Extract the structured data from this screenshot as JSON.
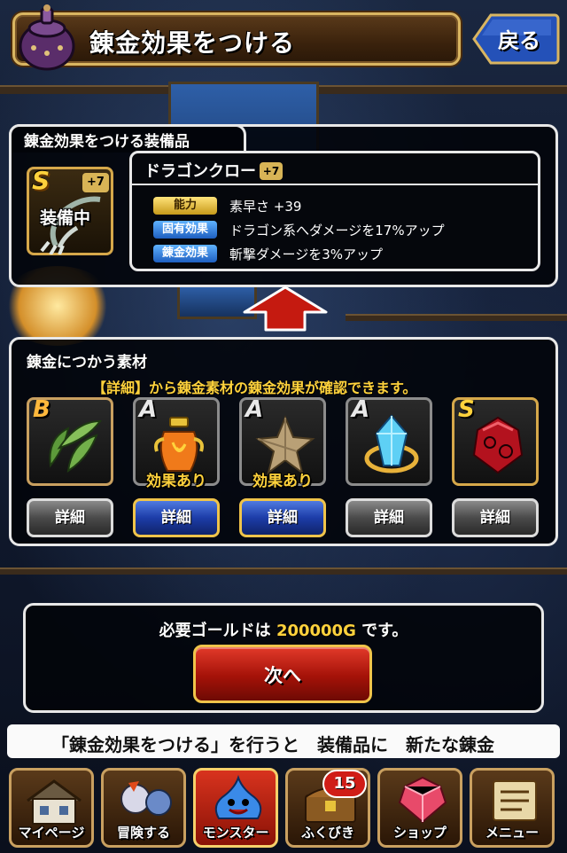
{
  "header": {
    "title": "錬金効果をつける",
    "back_label": "戻る"
  },
  "equipment": {
    "section_title": "錬金効果をつける装備品",
    "rank": "S",
    "plus": "+7",
    "equipped_badge": "装備中",
    "name": "ドラゴンクロー",
    "name_plus": "+7",
    "stats": [
      {
        "tag": "能力",
        "text": "素早さ +39",
        "color": "gold"
      },
      {
        "tag": "固有効果",
        "text": "ドラゴン系へダメージを17%アップ",
        "color": "blue"
      },
      {
        "tag": "錬金効果",
        "text": "斬撃ダメージを3%アップ",
        "color": "blue"
      }
    ]
  },
  "materials": {
    "section_title": "錬金につかう素材",
    "hint": "【詳細】から錬金素材の錬金効果が確認できます。",
    "items": [
      {
        "rank": "B",
        "effect": "",
        "detail_label": "詳細",
        "highlighted": false,
        "icon": "leaf-icon"
      },
      {
        "rank": "A",
        "effect": "効果あり",
        "detail_label": "詳細",
        "highlighted": true,
        "icon": "urn-icon"
      },
      {
        "rank": "A",
        "effect": "効果あり",
        "detail_label": "詳細",
        "highlighted": true,
        "icon": "star-rock-icon"
      },
      {
        "rank": "A",
        "effect": "",
        "detail_label": "詳細",
        "highlighted": false,
        "icon": "crystal-icon"
      },
      {
        "rank": "S",
        "effect": "",
        "detail_label": "詳細",
        "highlighted": false,
        "icon": "red-gem-icon"
      }
    ]
  },
  "gold": {
    "prefix": "必要ゴールドは ",
    "amount": "200000G",
    "suffix": " です。",
    "next_label": "次へ"
  },
  "ticker": {
    "text": "「錬金効果をつける」を行うと　装備品に　新たな錬金"
  },
  "nav": {
    "items": [
      {
        "label": "マイページ",
        "icon": "house-icon"
      },
      {
        "label": "冒険する",
        "icon": "monsters-icon"
      },
      {
        "label": "モンスター",
        "icon": "slime-icon",
        "active": true
      },
      {
        "label": "ふくびき",
        "icon": "chest-icon"
      },
      {
        "label": "ショップ",
        "icon": "gem-icon"
      },
      {
        "label": "メニュー",
        "icon": "scroll-icon"
      }
    ],
    "lottery_badge": "15"
  },
  "colors": {
    "gold_text": "#ffd23c",
    "panel_border": "#e8e8e8",
    "header_border": "#d9b561",
    "detail_highlight": "#1c3ca8",
    "next_button": "#a41208"
  }
}
